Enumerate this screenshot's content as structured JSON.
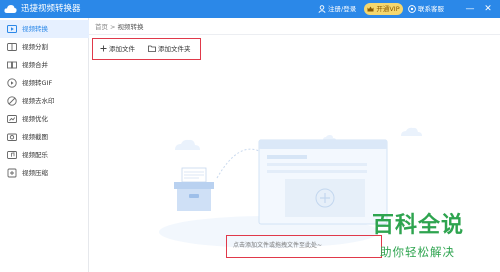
{
  "app": {
    "title": "迅捷视频转换器",
    "login_label": "注册/登录",
    "vip_label": "开通VIP",
    "support_label": "联系客服",
    "minimize": "—",
    "close": "✕"
  },
  "sidebar": {
    "items": [
      {
        "label": "视频转换",
        "icon": "video-convert-icon",
        "active": true
      },
      {
        "label": "视频分割",
        "icon": "scissors-icon",
        "active": false
      },
      {
        "label": "视频合并",
        "icon": "merge-icon",
        "active": false
      },
      {
        "label": "视频转GIF",
        "icon": "gif-icon",
        "active": false
      },
      {
        "label": "视频去水印",
        "icon": "watermark-remove-icon",
        "active": false
      },
      {
        "label": "视频优化",
        "icon": "optimize-icon",
        "active": false
      },
      {
        "label": "视频截图",
        "icon": "screenshot-icon",
        "active": false
      },
      {
        "label": "视频配乐",
        "icon": "music-icon",
        "active": false
      },
      {
        "label": "视频压缩",
        "icon": "compress-icon",
        "active": false
      }
    ]
  },
  "breadcrumb": {
    "home": "首页",
    "separator": ">",
    "current": "视频转换"
  },
  "toolbar": {
    "add_file": "添加文件",
    "add_folder": "添加文件夹"
  },
  "drop_hint": "点击添加文件或拖拽文件至此处~",
  "watermark": {
    "line1": "百科全说",
    "line2": "助你轻松解决"
  },
  "colors": {
    "brand_blue": "#2b88e8",
    "highlight_red": "#e0394a",
    "vip_gold": "#f5d76e",
    "watermark_green": "#2ea44f"
  }
}
